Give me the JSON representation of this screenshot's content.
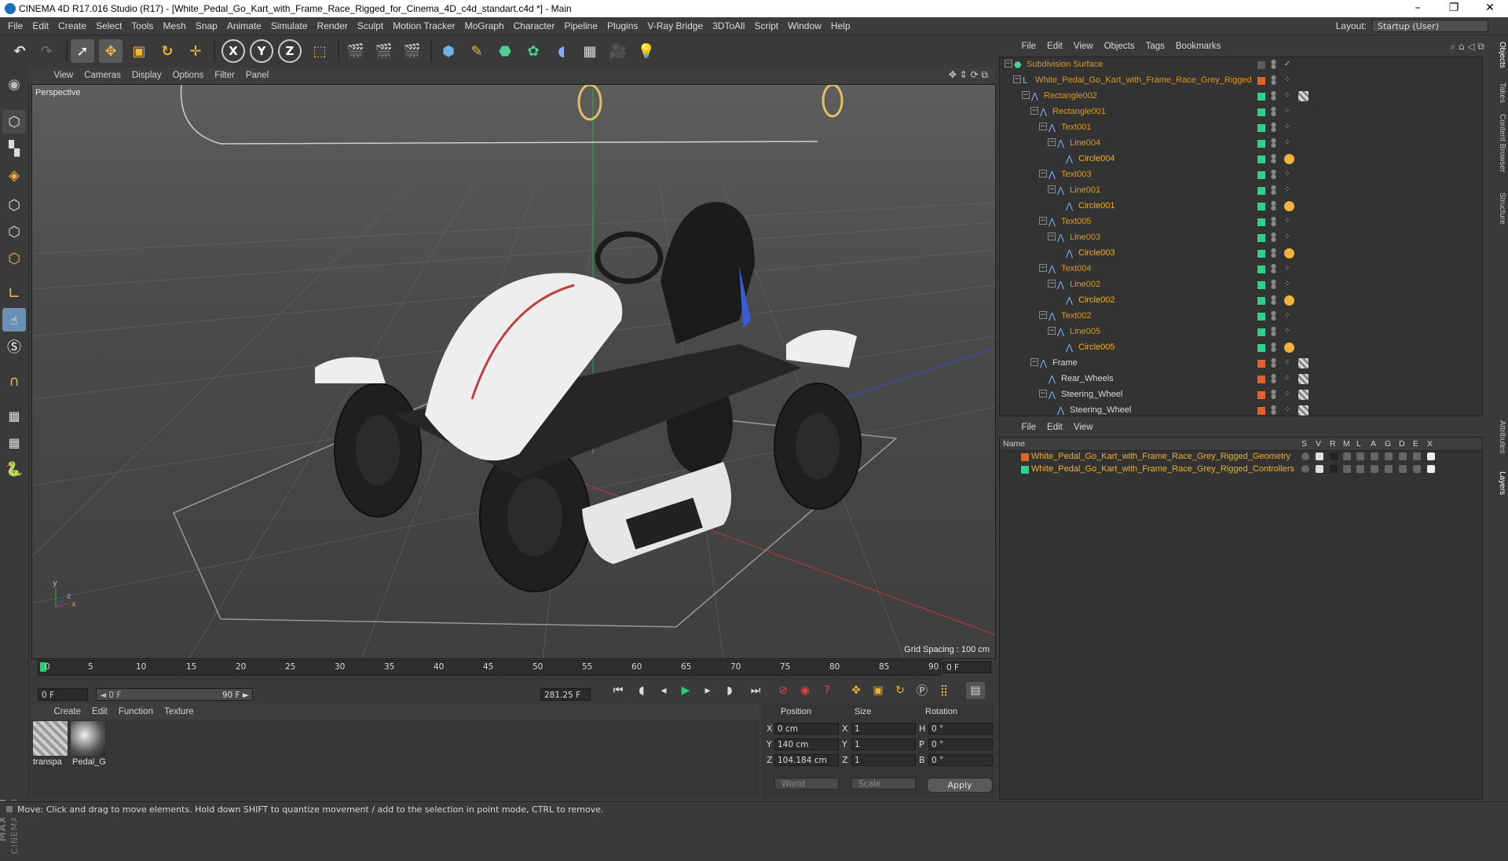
{
  "window": {
    "title": "CINEMA 4D R17.016 Studio (R17) - [White_Pedal_Go_Kart_with_Frame_Race_Rigged_for_Cinema_4D_c4d_standart.c4d *] - Main",
    "minimize": "–",
    "maximize": "❐",
    "close": "✕"
  },
  "menubar": {
    "items": [
      "File",
      "Edit",
      "Create",
      "Select",
      "Tools",
      "Mesh",
      "Snap",
      "Animate",
      "Simulate",
      "Render",
      "Sculpt",
      "Motion Tracker",
      "MoGraph",
      "Character",
      "Pipeline",
      "Plugins",
      "V-Ray Bridge",
      "3DToAll",
      "Script",
      "Window",
      "Help"
    ],
    "layout_label": "Layout:",
    "layout_value": "Startup (User)"
  },
  "toolbar": {
    "x_label": "X",
    "y_label": "Y",
    "z_label": "Z"
  },
  "viewport": {
    "menu": [
      "View",
      "Cameras",
      "Display",
      "Options",
      "Filter",
      "Panel"
    ],
    "label": "Perspective",
    "grid_spacing": "Grid Spacing : 100 cm",
    "axis_y": "y",
    "axis_z": "z",
    "axis_x": "x"
  },
  "timeline": {
    "ticks": [
      "0",
      "5",
      "10",
      "15",
      "20",
      "25",
      "30",
      "35",
      "40",
      "45",
      "50",
      "55",
      "60",
      "65",
      "70",
      "75",
      "80",
      "85",
      "90"
    ],
    "current_frame": "0 F",
    "start_field": "0 F",
    "range_start": "◄ 0 F",
    "range_end": "90 F ►",
    "end_field": "281.25 F"
  },
  "materials": {
    "menu": [
      "Create",
      "Edit",
      "Function",
      "Texture"
    ],
    "items": [
      {
        "name": "transpa"
      },
      {
        "name": "Pedal_G"
      }
    ]
  },
  "coordinates": {
    "headers": {
      "position": "Position",
      "size": "Size",
      "rotation": "Rotation"
    },
    "rows": [
      {
        "axis": "X",
        "pos": "0 cm",
        "size_axis": "X",
        "size": "1",
        "rot_axis": "H",
        "rot": "0 °"
      },
      {
        "axis": "Y",
        "pos": "140 cm",
        "size_axis": "Y",
        "size": "1",
        "rot_axis": "P",
        "rot": "0 °"
      },
      {
        "axis": "Z",
        "pos": "104.184 cm",
        "size_axis": "Z",
        "size": "1",
        "rot_axis": "B",
        "rot": "0 °"
      }
    ],
    "mode": "World",
    "scale": "Scale",
    "apply": "Apply"
  },
  "object_manager": {
    "menu": [
      "File",
      "Edit",
      "View",
      "Objects",
      "Tags",
      "Bookmarks"
    ],
    "objects": [
      {
        "name": "Subdivision Surface",
        "color": "#d79a1f",
        "swatch": "#5a5a5a"
      },
      {
        "name": "White_Pedal_Go_Kart_with_Frame_Race_Grey_Rigged",
        "color": "#d79a1f",
        "swatch": "#e0632a"
      },
      {
        "name": "Rectangle002",
        "color": "#d79a1f",
        "swatch": "#2fd08a"
      },
      {
        "name": "Rectangle001",
        "color": "#d79a1f",
        "swatch": "#2fd08a"
      },
      {
        "name": "Text001",
        "color": "#d79a1f",
        "swatch": "#2fd08a"
      },
      {
        "name": "Line004",
        "color": "#d79a1f",
        "swatch": "#2fd08a"
      },
      {
        "name": "Circle004",
        "color": "#f0b020",
        "swatch": "#2fd08a"
      },
      {
        "name": "Text003",
        "color": "#d79a1f",
        "swatch": "#2fd08a"
      },
      {
        "name": "Line001",
        "color": "#d79a1f",
        "swatch": "#2fd08a"
      },
      {
        "name": "Circle001",
        "color": "#f0b020",
        "swatch": "#2fd08a"
      },
      {
        "name": "Text005",
        "color": "#d79a1f",
        "swatch": "#2fd08a"
      },
      {
        "name": "Line003",
        "color": "#d79a1f",
        "swatch": "#2fd08a"
      },
      {
        "name": "Circle003",
        "color": "#f0b020",
        "swatch": "#2fd08a"
      },
      {
        "name": "Text004",
        "color": "#d79a1f",
        "swatch": "#2fd08a"
      },
      {
        "name": "Line002",
        "color": "#d79a1f",
        "swatch": "#2fd08a"
      },
      {
        "name": "Circle002",
        "color": "#f0b020",
        "swatch": "#2fd08a"
      },
      {
        "name": "Text002",
        "color": "#d79a1f",
        "swatch": "#2fd08a"
      },
      {
        "name": "Line005",
        "color": "#d79a1f",
        "swatch": "#2fd08a"
      },
      {
        "name": "Circle005",
        "color": "#f0b020",
        "swatch": "#2fd08a"
      },
      {
        "name": "Frame",
        "color": "#d8d8d8",
        "swatch": "#e0632a"
      },
      {
        "name": "Rear_Wheels",
        "color": "#d8d8d8",
        "swatch": "#e0632a"
      },
      {
        "name": "Steering_Wheel",
        "color": "#d8d8d8",
        "swatch": "#e0632a"
      },
      {
        "name": "Steering_Wheel",
        "color": "#d8d8d8",
        "swatch": "#e0632a"
      }
    ]
  },
  "layer_manager": {
    "menu": [
      "File",
      "Edit",
      "View"
    ],
    "header_name": "Name",
    "columns": [
      "S",
      "V",
      "R",
      "M",
      "L",
      "A",
      "G",
      "D",
      "E",
      "X"
    ],
    "layers": [
      {
        "name": "White_Pedal_Go_Kart_with_Frame_Race_Grey_Rigged_Geometry",
        "color": "#e0632a",
        "text_color": "#f0b020"
      },
      {
        "name": "White_Pedal_Go_Kart_with_Frame_Race_Grey_Rigged_Controllers",
        "color": "#2fd08a",
        "text_color": "#f0b020"
      }
    ]
  },
  "right_tabs": [
    "Objects",
    "Takes",
    "Content Browser",
    "Structure",
    "Attributes",
    "Layers"
  ],
  "status": "Move: Click and drag to move elements. Hold down SHIFT to quantize movement / add to the selection in point mode, CTRL to remove.",
  "maxon": {
    "line1": "MAXON",
    "line2": "CINEMA 4D"
  }
}
